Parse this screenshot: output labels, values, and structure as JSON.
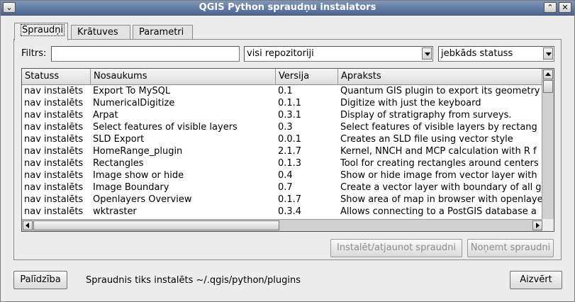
{
  "window": {
    "title": "QGIS Python spraudņu instalators"
  },
  "tabs": [
    {
      "label": "Spraudņi"
    },
    {
      "label": "Krātuves"
    },
    {
      "label": "Parametri"
    }
  ],
  "filter": {
    "label": "Filtrs:",
    "value": "",
    "repository_select": "visi repozitoriji",
    "status_select": "jebkāds statuss"
  },
  "table": {
    "headers": [
      "Statuss",
      "Nosaukums",
      "Versija",
      "Apraksts"
    ],
    "rows": [
      [
        "nav instalēts",
        "Export To MySQL",
        "0.1",
        "Quantum GIS plugin to export its geometry"
      ],
      [
        "nav instalēts",
        "NumericalDigitize",
        "0.1.1",
        "Digitize with just the keyboard"
      ],
      [
        "nav instalēts",
        "Arpat",
        "0.3.1",
        "Display of stratigraphy from surveys."
      ],
      [
        "nav instalēts",
        "Select features of visible layers",
        "0.3",
        "Select features of visible layers by rectang"
      ],
      [
        "nav instalēts",
        "SLD Export",
        "0.0.1",
        "Creates an SLD file using vector style"
      ],
      [
        "nav instalēts",
        "HomeRange_plugin",
        "2.1.7",
        "Kernel, NNCH and MCP calculation with R f"
      ],
      [
        "nav instalēts",
        "Rectangles",
        "0.1.3",
        "Tool for creating rectangles around centers"
      ],
      [
        "nav instalēts",
        "Image show or hide",
        "0.4",
        "Show or hide image from vector layer with"
      ],
      [
        "nav instalēts",
        "Image Boundary",
        "0.7",
        "Create a vector layer with boundary of all g"
      ],
      [
        "nav instalēts",
        "Openlayers Overview",
        "0.1.7",
        "Show area of map in browser with openlaye"
      ],
      [
        "nav instalēts",
        "wktraster",
        "0.3.4",
        "Allows connecting to a PostGIS database a"
      ]
    ]
  },
  "buttons": {
    "install": "Instalēt/atjaunot spraudni",
    "uninstall": "Noņemt spraudni",
    "help": "Palīdzība",
    "close": "Aizvērt"
  },
  "status_text": "Spraudnis tiks instalēts ~/.qgis/python/plugins"
}
